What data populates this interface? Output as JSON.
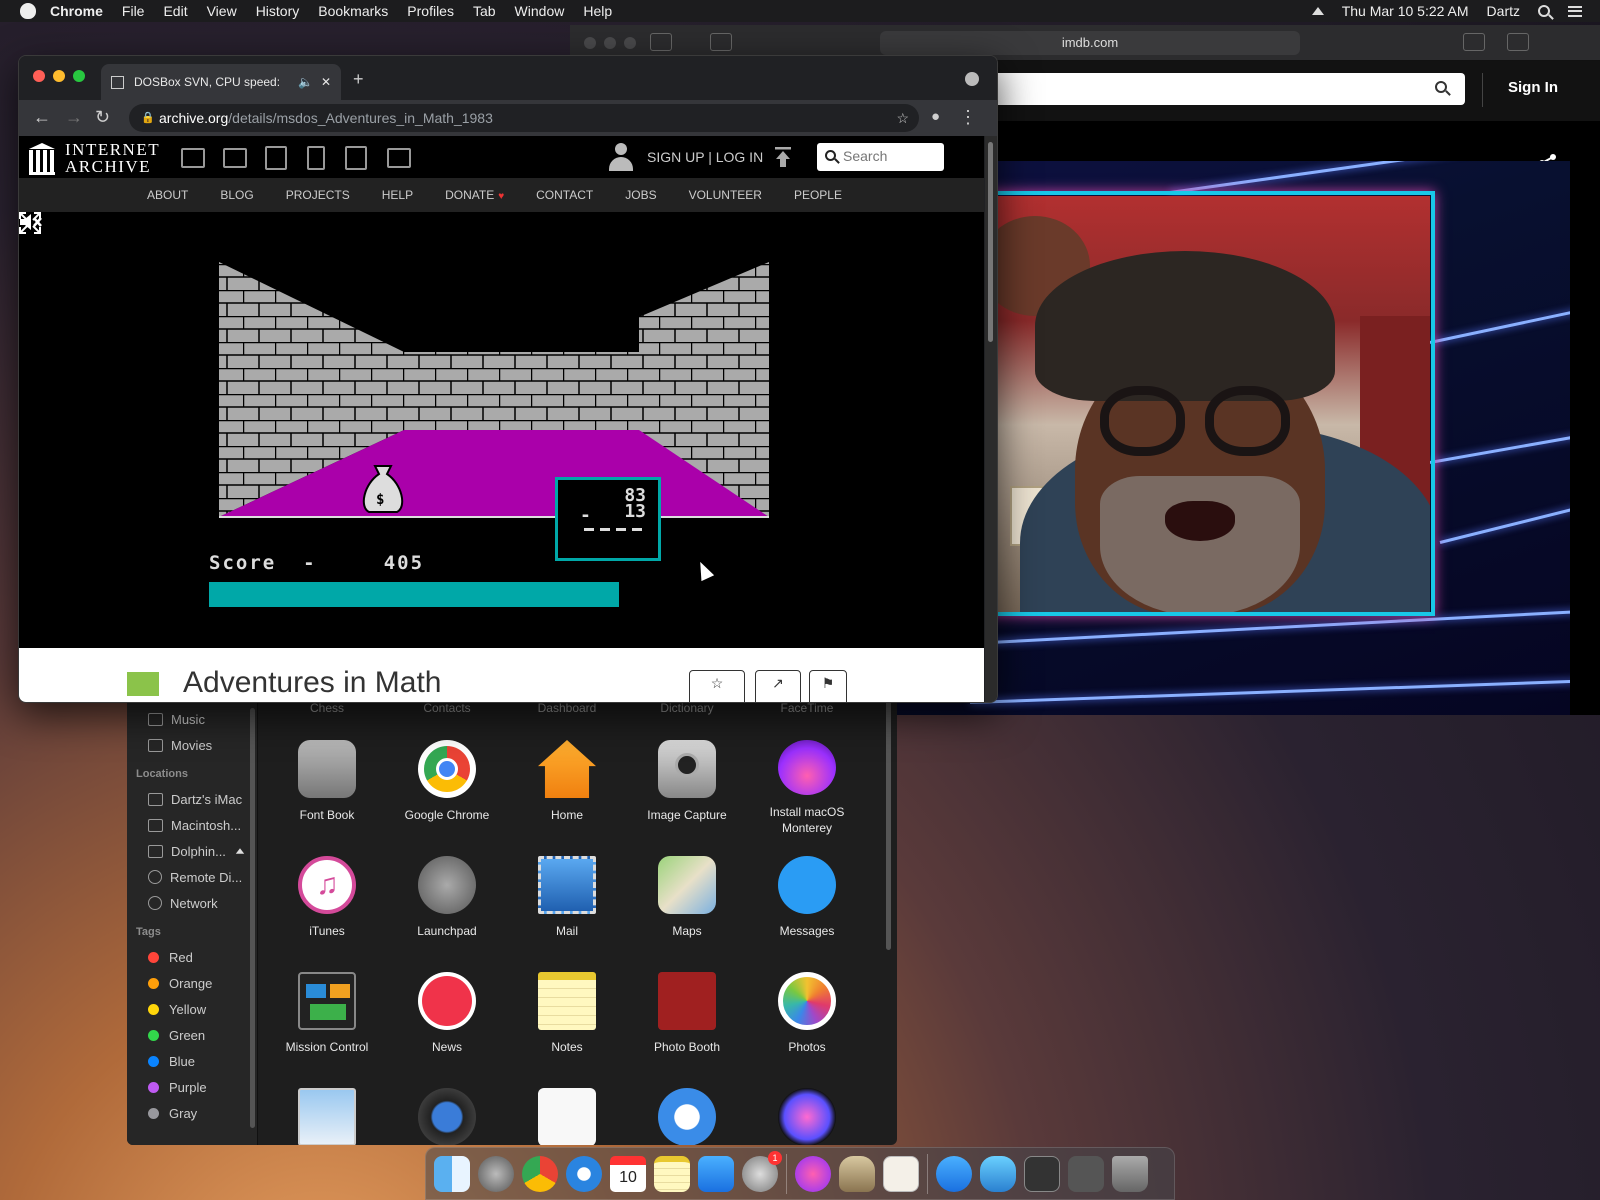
{
  "menubar": {
    "app": "Chrome",
    "items": [
      "File",
      "Edit",
      "View",
      "History",
      "Bookmarks",
      "Profiles",
      "Tab",
      "Window",
      "Help"
    ],
    "clock": "Thu Mar 10  5:22 AM",
    "user": "Dartz"
  },
  "safari": {
    "url": "imdb.com",
    "sign_in": "Sign In"
  },
  "chrome": {
    "tab_title": "DOSBox SVN, CPU speed:",
    "url_host": "archive.org",
    "url_path": "/details/msdos_Adventures_in_Math_1983"
  },
  "ia": {
    "logo_line1": "INTERNET",
    "logo_line2": "ARCHIVE",
    "signup": "SIGN UP | LOG IN",
    "search_placeholder": "Search",
    "nav": [
      "ABOUT",
      "BLOG",
      "PROJECTS",
      "HELP",
      "DONATE",
      "CONTACT",
      "JOBS",
      "VOLUNTEER",
      "PEOPLE"
    ],
    "item_title": "Adventures in Math",
    "item_buttons": [
      "☆",
      "↗",
      "⚑"
    ]
  },
  "game": {
    "score_label": "Score  -",
    "score_value": "405",
    "progress": 1.0,
    "problem_top": "83",
    "problem_op": "-",
    "problem_bottom": "13",
    "colors": {
      "floor": "#aa00aa",
      "wall": "#aaaaaa",
      "progress": "#00a8a8"
    }
  },
  "finder": {
    "sidebar_top": [
      "Music",
      "Movies"
    ],
    "locations_header": "Locations",
    "locations": [
      "Dartz's iMac",
      "Macintosh...",
      "Dolphin...",
      "Remote Di...",
      "Network"
    ],
    "tags_header": "Tags",
    "tags": [
      {
        "name": "Red",
        "color": "#ff453a"
      },
      {
        "name": "Orange",
        "color": "#ff9f0a"
      },
      {
        "name": "Yellow",
        "color": "#ffd60a"
      },
      {
        "name": "Green",
        "color": "#32d74b"
      },
      {
        "name": "Blue",
        "color": "#0a84ff"
      },
      {
        "name": "Purple",
        "color": "#bf5af2"
      },
      {
        "name": "Gray",
        "color": "#98989d"
      }
    ],
    "top_row": [
      "Chess",
      "Contacts",
      "Dashboard",
      "Dictionary",
      "FaceTime"
    ],
    "apps_row1": [
      "Font Book",
      "Google Chrome",
      "Home",
      "Image Capture",
      "Install macOS Monterey"
    ],
    "apps_row2": [
      "iTunes",
      "Launchpad",
      "Mail",
      "Maps",
      "Messages"
    ],
    "apps_row3": [
      "Mission Control",
      "News",
      "Notes",
      "Photo Booth",
      "Photos"
    ]
  },
  "dock": {
    "calendar_day": "10",
    "badge": "1"
  }
}
